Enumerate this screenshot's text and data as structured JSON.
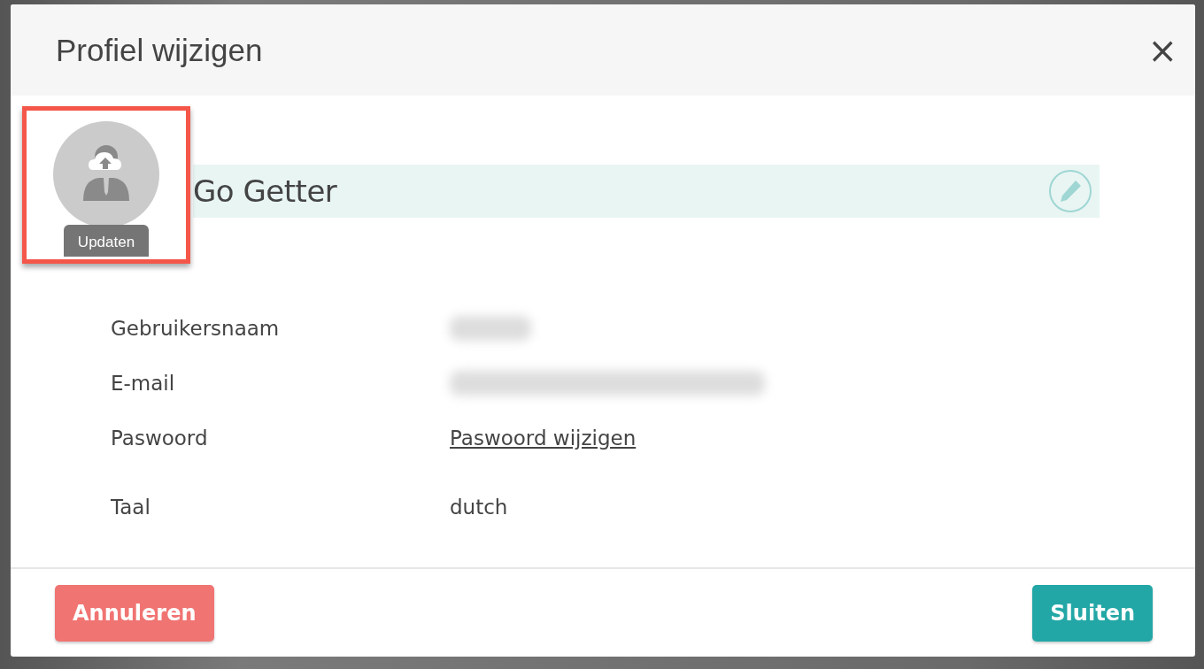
{
  "dialog": {
    "title": "Profiel wijzigen",
    "close": "×"
  },
  "avatar": {
    "button": "Updaten",
    "highlighted": true
  },
  "name": {
    "value": "Go Getter"
  },
  "fields": [
    {
      "label": "Gebruikersnaam",
      "kind": "redacted"
    },
    {
      "label": "E-mail",
      "kind": "redacted"
    },
    {
      "label": "Paswoord",
      "kind": "link",
      "value": "Paswoord wijzigen"
    },
    {
      "label": "Taal",
      "kind": "text",
      "value": "dutch"
    }
  ],
  "buttons": [
    {
      "label": "Annuleren",
      "kind": "cancel"
    },
    {
      "label": "Sluiten",
      "kind": "primary"
    }
  ]
}
